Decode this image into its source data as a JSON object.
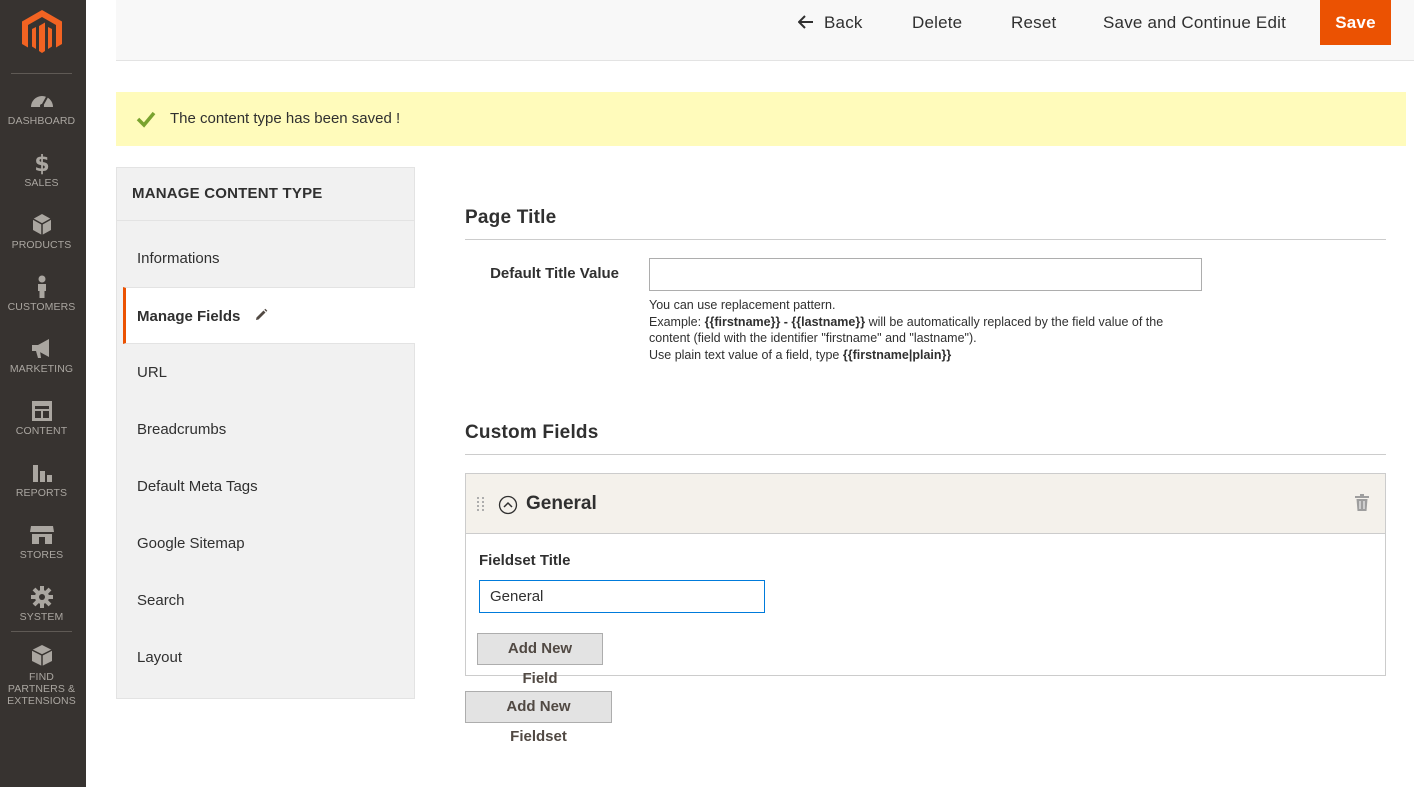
{
  "menu": {
    "items": [
      {
        "label": "DASHBOARD",
        "icon": "dashboard-icon"
      },
      {
        "label": "SALES",
        "icon": "dollar-icon"
      },
      {
        "label": "PRODUCTS",
        "icon": "box-icon"
      },
      {
        "label": "CUSTOMERS",
        "icon": "person-icon"
      },
      {
        "label": "MARKETING",
        "icon": "megaphone-icon"
      },
      {
        "label": "CONTENT",
        "icon": "layout-icon"
      },
      {
        "label": "REPORTS",
        "icon": "bar-chart-icon"
      },
      {
        "label": "STORES",
        "icon": "storefront-icon"
      },
      {
        "label": "SYSTEM",
        "icon": "gear-icon"
      },
      {
        "label": "FIND PARTNERS & EXTENSIONS",
        "icon": "cube-icon"
      }
    ]
  },
  "actions": {
    "back": "Back",
    "delete": "Delete",
    "reset": "Reset",
    "save_continue": "Save and Continue Edit",
    "save": "Save"
  },
  "message": {
    "text": "The content type has been saved !"
  },
  "tabs": {
    "title": "MANAGE CONTENT TYPE",
    "items": [
      {
        "label": "Informations"
      },
      {
        "label": "Manage Fields"
      },
      {
        "label": "URL"
      },
      {
        "label": "Breadcrumbs"
      },
      {
        "label": "Default Meta Tags"
      },
      {
        "label": "Google Sitemap"
      },
      {
        "label": "Search"
      },
      {
        "label": "Layout"
      }
    ]
  },
  "page_title": {
    "heading": "Page Title",
    "field_label": "Default Title Value",
    "value": "",
    "note": {
      "line1": "You can use replacement pattern.",
      "example_prefix": "Example: ",
      "example_code": "{{firstname}} - {{lastname}}",
      "example_suffix": " will be automatically replaced by the field value of the content (field with the identifier \"firstname\" and \"lastname\").",
      "plain_prefix": "Use plain text value of a field, type ",
      "plain_code": "{{firstname|plain}}"
    }
  },
  "custom_fields": {
    "heading": "Custom Fields",
    "fieldset": {
      "name": "General",
      "title_label": "Fieldset Title",
      "title_value": "General",
      "add_field": "Add New Field"
    },
    "add_fieldset": "Add New Fieldset"
  },
  "colors": {
    "accent": "#eb5202",
    "menu_bg": "#373330",
    "message_bg": "#fffbbb",
    "success": "#79a22e"
  }
}
